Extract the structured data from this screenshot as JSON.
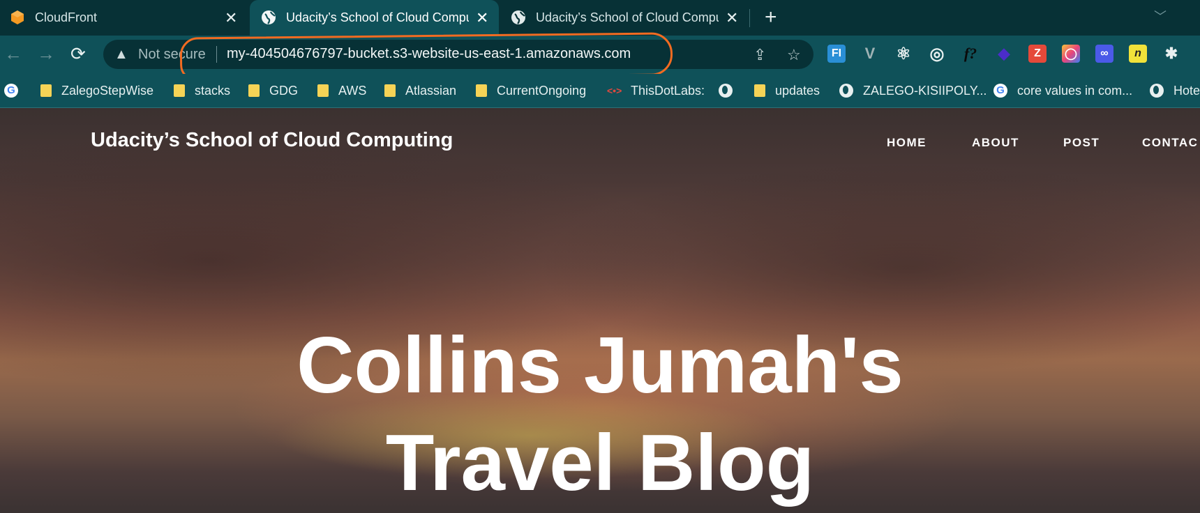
{
  "browser": {
    "tabs": [
      {
        "title": "CloudFront",
        "icon": "aws-cloudfront-icon",
        "active": false
      },
      {
        "title": "Udacity’s School of Cloud Computing",
        "icon": "globe-icon",
        "active": true
      },
      {
        "title": "Udacity’s School of Cloud Computing",
        "icon": "globe-icon",
        "active": false
      }
    ],
    "new_tab_label": "+",
    "address_bar": {
      "security_label": "Not secure",
      "url": "my-404504676797-bucket.s3-website-us-east-1.amazonaws.com"
    },
    "extensions": [
      "fi-icon",
      "vue-icon",
      "react-icon",
      "target-icon",
      "fx-icon",
      "stack-icon",
      "zotero-icon",
      "colorpick-icon",
      "link-icon",
      "n-icon",
      "puzzle-icon"
    ],
    "extension_labels": [
      "FI",
      "V",
      "⚛",
      "◎",
      "f?",
      "◆",
      "Z",
      "◯",
      "∞",
      "n",
      "✱"
    ],
    "bookmarks": [
      {
        "label": "",
        "icon": "google-icon"
      },
      {
        "label": "ZalegoStepWise",
        "icon": "folder-icon"
      },
      {
        "label": "stacks",
        "icon": "folder-icon"
      },
      {
        "label": "GDG",
        "icon": "folder-icon"
      },
      {
        "label": "AWS",
        "icon": "folder-icon"
      },
      {
        "label": "Atlassian",
        "icon": "folder-icon"
      },
      {
        "label": "CurrentOngoing",
        "icon": "folder-icon"
      },
      {
        "label": "ThisDotLabs:",
        "icon": "thisdotlabs-icon"
      },
      {
        "label": "",
        "icon": "globe-icon"
      },
      {
        "label": "updates",
        "icon": "folder-icon"
      },
      {
        "label": "ZALEGO-KISIIPOLY...",
        "icon": "globe-icon"
      },
      {
        "label": "core values in com...",
        "icon": "google-icon"
      },
      {
        "label": "Hote",
        "icon": "globe-icon"
      }
    ]
  },
  "site": {
    "brand": "Udacity’s School of Cloud Computing",
    "nav": [
      "HOME",
      "ABOUT",
      "POST",
      "CONTAC"
    ],
    "hero_line1": "Collins Jumah's",
    "hero_line2": "Travel Blog"
  },
  "colors": {
    "annotation": "#f26b21",
    "tabbar": "#073136",
    "toolbar": "#0f5159"
  }
}
